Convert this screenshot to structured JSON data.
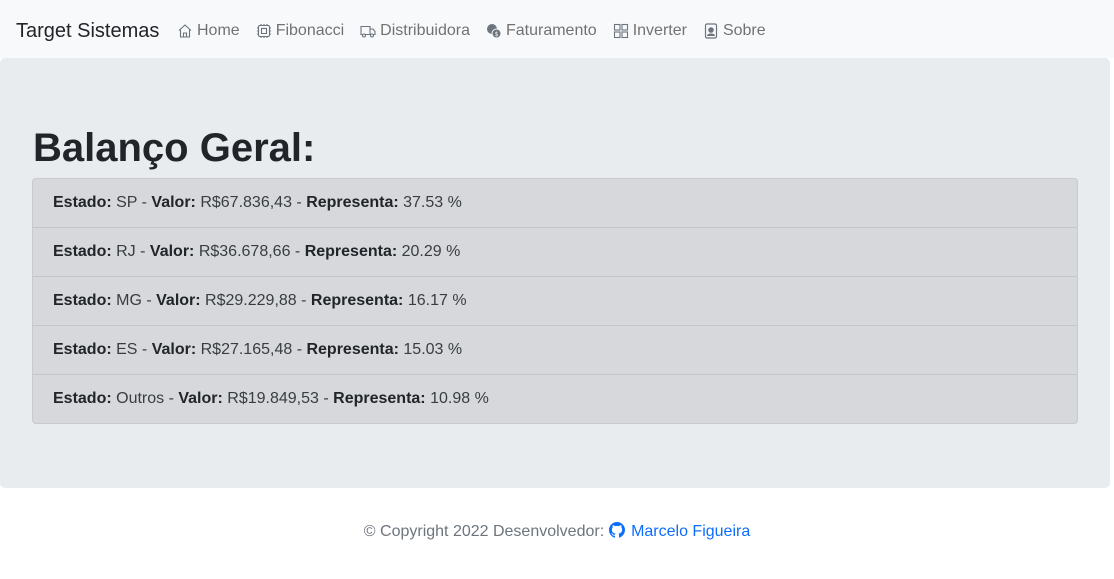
{
  "navbar": {
    "brand": "Target Sistemas",
    "links": [
      {
        "label": "Home",
        "icon": "house-icon"
      },
      {
        "label": "Fibonacci",
        "icon": "cpu-icon"
      },
      {
        "label": "Distribuidora",
        "icon": "truck-icon"
      },
      {
        "label": "Faturamento",
        "icon": "coins-icon"
      },
      {
        "label": "Inverter",
        "icon": "grid-icon"
      },
      {
        "label": "Sobre",
        "icon": "person-badge-icon"
      }
    ]
  },
  "main": {
    "title": "Balanço Geral:",
    "labels": {
      "estado": "Estado:",
      "valor": "Valor:",
      "representa": "Representa:",
      "sep": " - "
    },
    "items": [
      {
        "estado": "SP",
        "valor": "R$67.836,43",
        "representa": "37.53 %"
      },
      {
        "estado": "RJ",
        "valor": "R$36.678,66",
        "representa": "20.29 %"
      },
      {
        "estado": "MG",
        "valor": "R$29.229,88",
        "representa": "16.17 %"
      },
      {
        "estado": "ES",
        "valor": "R$27.165,48",
        "representa": "15.03 %"
      },
      {
        "estado": "Outros",
        "valor": "R$19.849,53",
        "representa": "10.98 %"
      }
    ]
  },
  "footer": {
    "text": "© Copyright 2022 Desenvolvedor:",
    "author": "Marcelo Figueira",
    "author_icon": "github-icon"
  },
  "colors": {
    "navbar_bg": "#f8f9fa",
    "jumbotron_bg": "#e9ecef",
    "list_bg": "#d6d8db",
    "link": "#0d6efd"
  }
}
